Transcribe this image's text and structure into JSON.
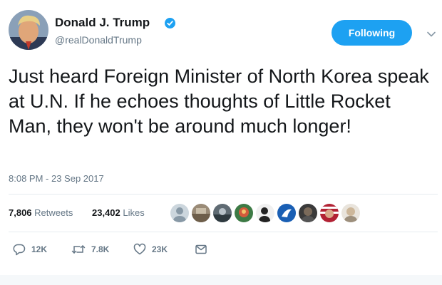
{
  "author": {
    "name": "Donald J. Trump",
    "handle": "@realDonaldTrump",
    "verified_icon": "verified-badge-icon"
  },
  "follow_button": {
    "label": "Following"
  },
  "tweet": {
    "text": "Just heard Foreign Minister of North Korea speak at U.N. If he echoes thoughts of Little Rocket Man, they won't be around much longer!",
    "timestamp": "8:08 PM - 23 Sep 2017"
  },
  "stats": {
    "retweets_count": "7,806",
    "retweets_label": "Retweets",
    "likes_count": "23,402",
    "likes_label": "Likes"
  },
  "actions": {
    "reply_count": "12K",
    "retweet_count": "7.8K",
    "like_count": "23K"
  },
  "colors": {
    "accent": "#1da1f2",
    "secondary_text": "#657786",
    "primary_text": "#14171a",
    "divider": "#e6ecf0"
  }
}
